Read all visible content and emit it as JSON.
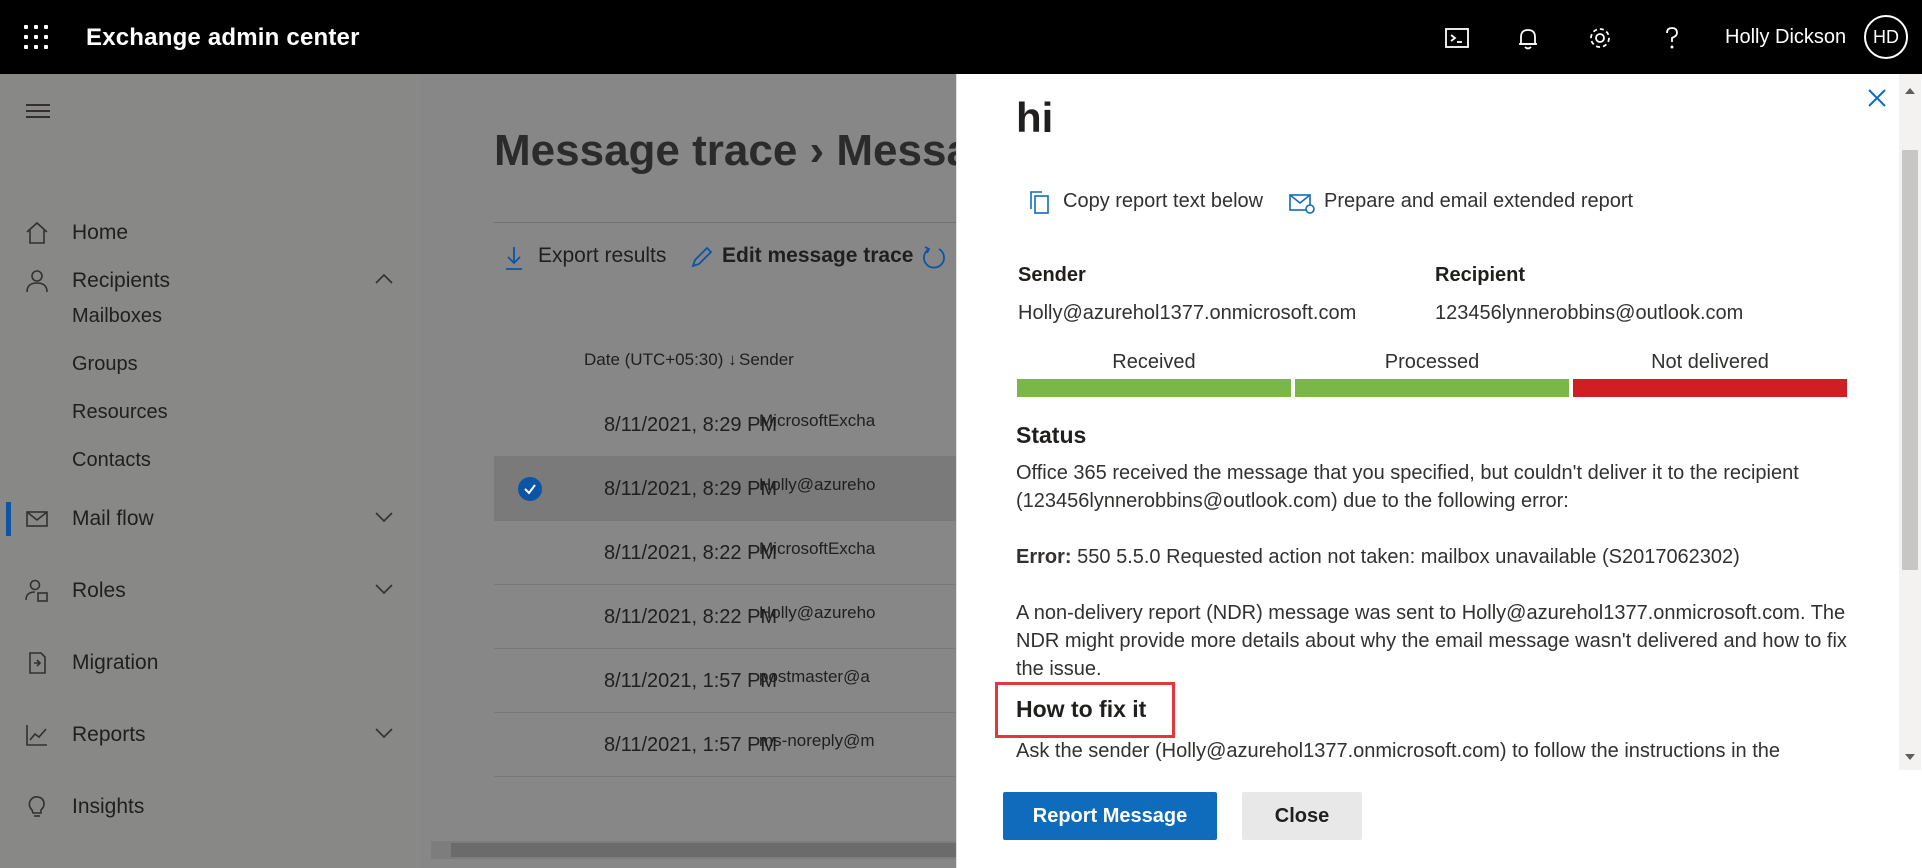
{
  "app": {
    "title": "Exchange admin center",
    "user_name": "Holly Dickson",
    "user_initials": "HD"
  },
  "topbar_icons": [
    "terminal-icon",
    "bell-icon",
    "gear-icon",
    "help-icon"
  ],
  "sidebar": {
    "items": [
      {
        "label": "Home",
        "icon": "home-icon"
      },
      {
        "label": "Recipients",
        "icon": "person-icon",
        "expanded": true
      },
      {
        "label": "Mail flow",
        "icon": "mail-icon",
        "active": true
      },
      {
        "label": "Roles",
        "icon": "roles-icon"
      },
      {
        "label": "Migration",
        "icon": "migration-icon"
      },
      {
        "label": "Reports",
        "icon": "chart-icon"
      },
      {
        "label": "Insights",
        "icon": "lightbulb-icon"
      }
    ],
    "sub_items": [
      "Mailboxes",
      "Groups",
      "Resources",
      "Contacts"
    ]
  },
  "main": {
    "title": "Message trace › Message",
    "commands": {
      "export": "Export results",
      "edit": "Edit message trace",
      "refresh": "R"
    },
    "columns": {
      "date": "Date (UTC+05:30) ↓",
      "sender": "Sender"
    },
    "rows": [
      {
        "date": "8/11/2021, 8:29 PM",
        "sender": "MicrosoftExcha"
      },
      {
        "date": "8/11/2021, 8:29 PM",
        "sender": "Holly@azureho",
        "selected": true
      },
      {
        "date": "8/11/2021, 8:22 PM",
        "sender": "MicrosoftExcha"
      },
      {
        "date": "8/11/2021, 8:22 PM",
        "sender": "Holly@azureho"
      },
      {
        "date": "8/11/2021, 1:57 PM",
        "sender": "postmaster@a"
      },
      {
        "date": "8/11/2021, 1:57 PM",
        "sender": "ms-noreply@m"
      }
    ]
  },
  "panel": {
    "title": "hi",
    "actions": {
      "copy": "Copy report text below",
      "email": "Prepare and email extended report"
    },
    "sender_label": "Sender",
    "sender_value": "Holly@azurehol1377.onmicrosoft.com",
    "recipient_label": "Recipient",
    "recipient_value": "123456lynnerobbins@outlook.com",
    "stages": [
      {
        "label": "Received",
        "color": "#7ab648"
      },
      {
        "label": "Processed",
        "color": "#7ab648"
      },
      {
        "label": "Not delivered",
        "color": "#cf1f25"
      }
    ],
    "status_heading": "Status",
    "status_text": "Office 365 received the message that you specified, but couldn't deliver it to the recipient (123456lynnerobbins@outlook.com) due to the following error:",
    "error_label": "Error:",
    "error_text": "550 5.5.0 Requested action not taken: mailbox unavailable (S2017062302)",
    "ndr_text": "A non-delivery report (NDR) message was sent to Holly@azurehol1377.onmicrosoft.com. The NDR might provide more details about why the email message wasn't delivered and how to fix the issue.",
    "fix_heading": "How to fix it",
    "fix_text": "Ask the sender (Holly@azurehol1377.onmicrosoft.com) to follow the instructions in the",
    "buttons": {
      "report": "Report Message",
      "close": "Close"
    }
  },
  "colors": {
    "accent": "#0f6cbd",
    "highlight_box": "#e0383d"
  }
}
